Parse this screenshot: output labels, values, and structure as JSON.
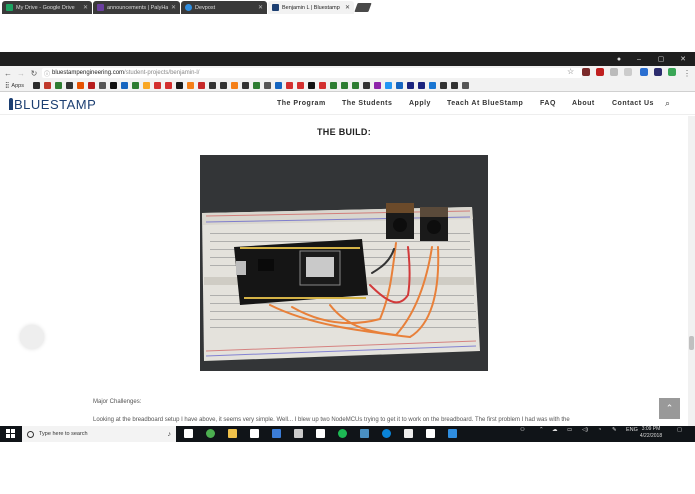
{
  "tabs": [
    {
      "title": "My Drive - Google Drive",
      "icon": "google-drive-icon",
      "color": "#1ea362"
    },
    {
      "title": "announcements | PalyHa",
      "icon": "palyhacks-icon",
      "color": "#6b3fa0"
    },
    {
      "title": "Devpost",
      "icon": "devpost-icon",
      "color": "#2f8ee0"
    },
    {
      "title": "Benjamin L | Bluestamp",
      "icon": "bluestamp-icon",
      "color": "#1c3f72"
    }
  ],
  "window_controls": {
    "user": "●",
    "minimize": "–",
    "maximize": "▢",
    "close": "✕"
  },
  "omnibox": {
    "domain": "bluestampengineering.com",
    "path": "/student-projects/benjamin-l/"
  },
  "bookmarks": {
    "apps_label": "Apps"
  },
  "site": {
    "logo_text": "BLUESTAMP",
    "nav": [
      "The Program",
      "The Students",
      "Apply",
      "Teach At BlueStamp",
      "FAQ",
      "About",
      "Contact Us"
    ]
  },
  "content": {
    "heading": "THE BUILD:",
    "photo_alt": "",
    "challenges_label": "Major Challenges:",
    "paragraph": "Looking at the breadboard setup I have above, it seems very simple. Well... I blew up two NodeMCUs trying to get it to work on the breadboard. The first problem I had was with the"
  },
  "taskbar": {
    "search_placeholder": "Type here to search",
    "tray_lang": "ENG",
    "time": "3:09 PM",
    "date": "4/22/2018"
  },
  "colors": {
    "brand": "#1c3f72",
    "taskbar": "#101418",
    "chrome_dark": "#1f1f1f"
  }
}
